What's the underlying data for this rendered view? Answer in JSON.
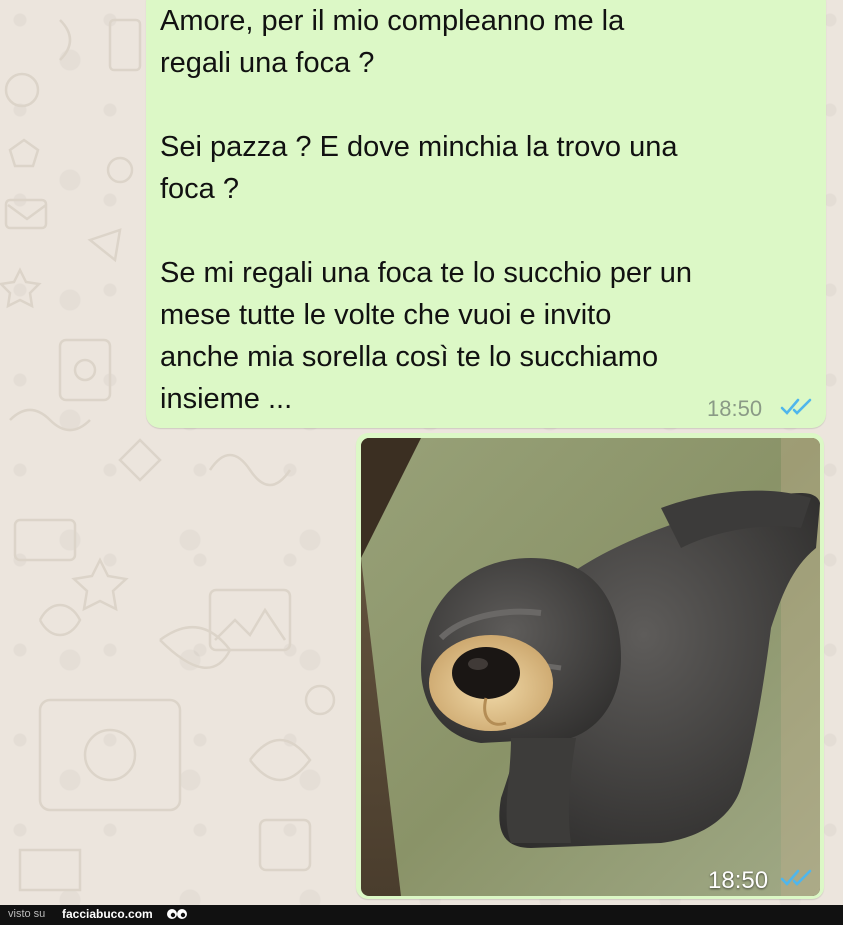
{
  "chat": {
    "message": {
      "lines": [
        "Amore, per il mio compleanno me la",
        "regali una foca ?",
        "Sei pazza ? E dove minchia la trovo una",
        "foca ?",
        "Se mi regali una foca te lo succhio per un",
        "mese tutte le volte che vuoi e invito",
        "anche mia sorella così te lo succhiamo",
        "insieme ..."
      ],
      "time": "18:50",
      "status_icon": "double-check-read-icon"
    },
    "image_message": {
      "time": "18:50",
      "status_icon": "double-check-read-icon"
    }
  },
  "footer": {
    "visto": "visto su",
    "site": "facciabuco.com",
    "logo_icon": "eyes-icon"
  },
  "colors": {
    "chat_background": "#ece5dd",
    "outgoing_bubble": "#dcf8c6",
    "read_ticks": "#4fb6ec",
    "footer_bg": "#111111"
  }
}
